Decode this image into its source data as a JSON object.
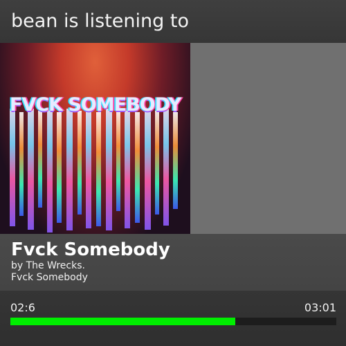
{
  "header": {
    "text": "bean is listening to"
  },
  "album_art": {
    "title_text": "FVCK SOMEBODY"
  },
  "track": {
    "title": "Fvck Somebody",
    "artist_line": "by The Wrecks.",
    "album": "Fvck Somebody"
  },
  "progress": {
    "elapsed": "02:6",
    "total": "03:01",
    "fraction": 0.69,
    "fill_color": "#00ee00",
    "track_color": "#1d1d1d"
  }
}
